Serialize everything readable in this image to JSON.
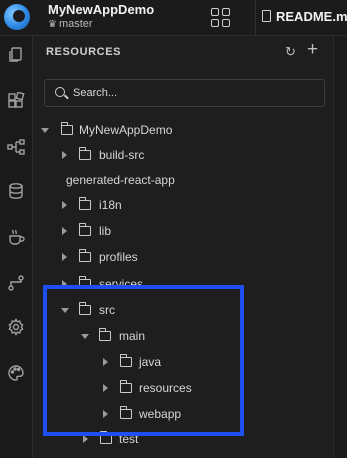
{
  "header": {
    "app_title": "MyNewAppDemo",
    "branch": "master",
    "editor_tab": "README.m"
  },
  "activity_bar": {
    "icons": [
      "files-icon",
      "blocks-icon",
      "diagram-icon",
      "database-icon",
      "coffee-icon",
      "flow-icon",
      "gear-icon",
      "palette-icon"
    ]
  },
  "explorer": {
    "title": "RESOURCES",
    "search_placeholder": "Search...",
    "tree": [
      {
        "label": "MyNewAppDemo",
        "expanded": true,
        "level": 0
      },
      {
        "label": "build-src",
        "expanded": false,
        "level": 1
      },
      {
        "label": "generated-react-app",
        "level": 1
      },
      {
        "label": "i18n",
        "expanded": false,
        "level": 1
      },
      {
        "label": "lib",
        "expanded": false,
        "level": 1
      },
      {
        "label": "profiles",
        "expanded": false,
        "level": 1
      },
      {
        "label": "services",
        "expanded": false,
        "level": 1
      },
      {
        "label": "src",
        "expanded": true,
        "level": 1
      },
      {
        "label": "main",
        "expanded": true,
        "level": 2
      },
      {
        "label": "java",
        "expanded": false,
        "level": 3
      },
      {
        "label": "resources",
        "expanded": false,
        "level": 3
      },
      {
        "label": "webapp",
        "expanded": false,
        "level": 3
      },
      {
        "label": "test",
        "expanded": false,
        "level": 2
      }
    ]
  },
  "colors": {
    "highlight_box": "#1f4ff0",
    "background": "#1e1e1e"
  }
}
